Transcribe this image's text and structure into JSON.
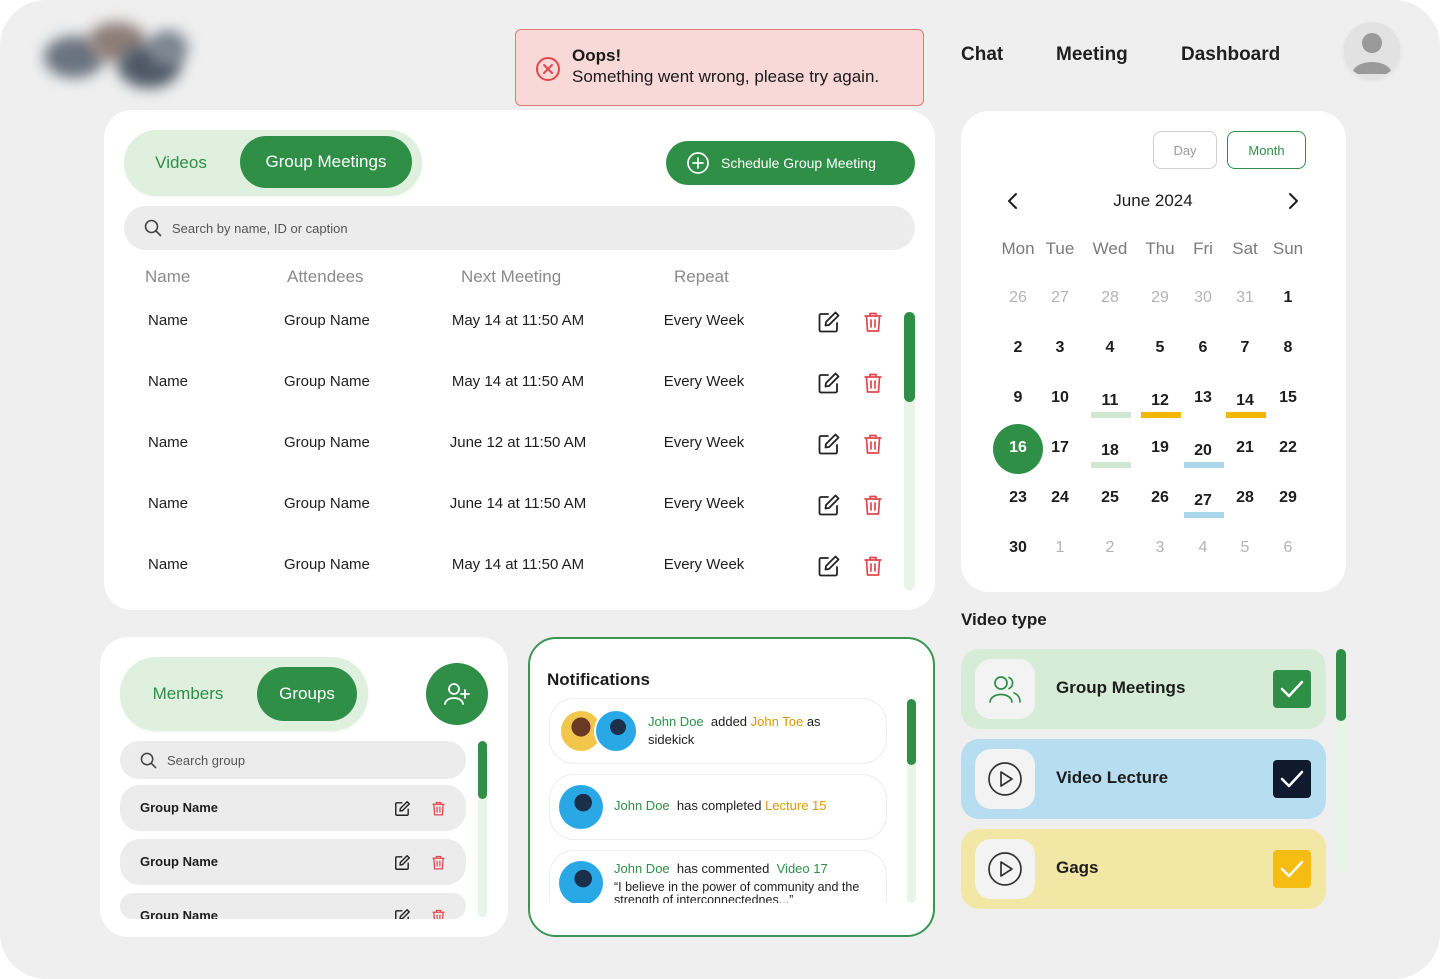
{
  "header": {
    "nav": [
      "Chat",
      "Meeting",
      "Dashboard"
    ]
  },
  "toast": {
    "title": "Oops!",
    "message": "Something went wrong, please try again."
  },
  "meetings_panel": {
    "tabs": [
      "Videos",
      "Group Meetings"
    ],
    "active_tab": "Group Meetings",
    "schedule_button": "Schedule Group Meeting",
    "search_placeholder": "Search by name, ID or caption",
    "columns": [
      "Name",
      "Attendees",
      "Next Meeting",
      "Repeat"
    ],
    "rows": [
      {
        "name": "Name",
        "attendees": "Group Name",
        "next": "May 14 at 11:50 AM",
        "repeat": "Every Week"
      },
      {
        "name": "Name",
        "attendees": "Group Name",
        "next": "May 14 at 11:50 AM",
        "repeat": "Every Week"
      },
      {
        "name": "Name",
        "attendees": "Group Name",
        "next": "June 12 at 11:50 AM",
        "repeat": "Every Week"
      },
      {
        "name": "Name",
        "attendees": "Group Name",
        "next": "June 14 at 11:50 AM",
        "repeat": "Every Week"
      },
      {
        "name": "Name",
        "attendees": "Group Name",
        "next": "May 14 at 11:50 AM",
        "repeat": "Every Week"
      }
    ],
    "icons": {
      "edit": "edit-icon",
      "delete": "trash-icon"
    }
  },
  "groups_panel": {
    "tabs": [
      "Members",
      "Groups"
    ],
    "active_tab": "Groups",
    "search_placeholder": "Search group",
    "items": [
      "Group Name",
      "Group Name",
      "Group Name"
    ],
    "add_icon": "add-user-icon"
  },
  "notifications": {
    "title": "Notifications",
    "items": [
      {
        "actor": "John Doe",
        "action": "added",
        "target": "John Toe",
        "rest": "as",
        "line2": "sidekick"
      },
      {
        "actor": "John Doe",
        "action": "has completed",
        "target": "Lecture 15"
      },
      {
        "actor": "John Doe",
        "action": "has commented",
        "target": "Video 17",
        "quote": "“I believe in the power of community and the strength of interconnectednes...”"
      }
    ]
  },
  "calendar": {
    "views": [
      "Day",
      "Month"
    ],
    "active_view": "Month",
    "month_label": "June 2024",
    "weekdays": [
      "Mon",
      "Tue",
      "Wed",
      "Thu",
      "Fri",
      "Sat",
      "Sun"
    ],
    "weeks": [
      [
        "26",
        "27",
        "28",
        "29",
        "30",
        "31",
        "1"
      ],
      [
        "2",
        "3",
        "4",
        "5",
        "6",
        "7",
        "8"
      ],
      [
        "9",
        "10",
        "11",
        "12",
        "13",
        "14",
        "15"
      ],
      [
        "16",
        "17",
        "18",
        "19",
        "20",
        "21",
        "22"
      ],
      [
        "23",
        "24",
        "25",
        "26",
        "27",
        "28",
        "29"
      ],
      [
        "30",
        "1",
        "2",
        "3",
        "4",
        "5",
        "6"
      ]
    ],
    "selected_day": "16",
    "event_colors": {
      "group": "#cfe8d2",
      "gag": "#f2b705",
      "lecture": "#a9d8eb"
    },
    "accent": "#2f8f47"
  },
  "video_type": {
    "title": "Video type",
    "items": [
      {
        "label": "Group Meetings",
        "icon": "users-icon",
        "bg": "#d7ecd7",
        "check_color": "#2f8f47",
        "checked": true
      },
      {
        "label": "Video Lecture",
        "icon": "play-icon",
        "bg": "#b7def0",
        "check_color": "#0f1a2e",
        "checked": true
      },
      {
        "label": "Gags",
        "icon": "play-icon",
        "bg": "#f3e7a6",
        "check_color": "#f5bd12",
        "checked": true
      }
    ]
  },
  "colors": {
    "primary": "#2f8f47",
    "danger": "#e0474c",
    "toast_bg": "#f9d8d8"
  }
}
